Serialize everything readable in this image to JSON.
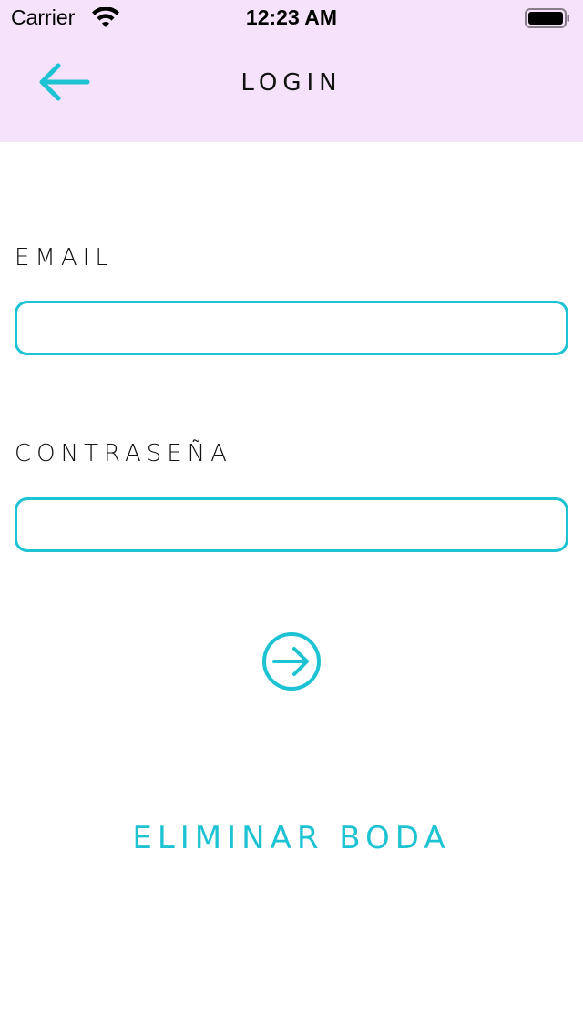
{
  "status_bar": {
    "carrier": "Carrier",
    "time": "12:23 AM",
    "icons": [
      "wifi-icon",
      "battery-icon"
    ]
  },
  "nav": {
    "title": "LOGIN",
    "back_icon": "arrow-left-icon"
  },
  "form": {
    "email_label": "EMAIL",
    "email_value": "",
    "password_label": "CONTRASEÑA",
    "password_value": "",
    "submit_icon": "arrow-right-circle-icon"
  },
  "actions": {
    "delete_label": "ELIMINAR BODA"
  },
  "colors": {
    "accent": "#1ec3d3",
    "header_bg": "#f6e3fb",
    "text": "#111111"
  }
}
